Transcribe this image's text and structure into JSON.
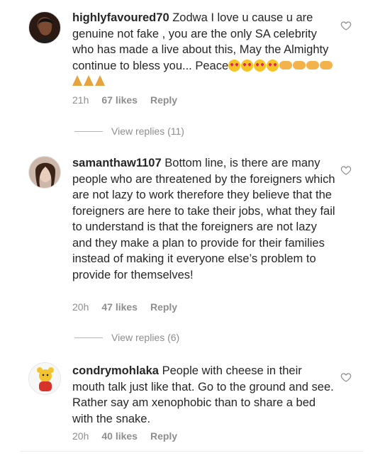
{
  "comments": [
    {
      "username": "highlyfavoured70",
      "text": "Zodwa I love u cause u are genuine not fake , you are the only SA celebrity who has made a live about this, May the Almighty continue to bless you... Peace",
      "emojis": [
        "heart-eyes",
        "heart-eyes",
        "heart-eyes",
        "heart-eyes",
        "handshake",
        "handshake",
        "handshake",
        "handshake",
        "pray",
        "pray",
        "pray"
      ],
      "time": "21h",
      "likes": "67 likes",
      "reply": "Reply",
      "view_replies": "View replies (11)"
    },
    {
      "username": "samanthaw1107",
      "text": "Bottom line, is there are many people who are threatened by the foreigners which are not lazy to work therefore they believe that the foreigners are here to take their jobs, what they fail to understand is that the foreigners are not lazy and they make a plan to provide for their families instead of making it everyone else’s problem to provide for themselves!",
      "time": "20h",
      "likes": "47 likes",
      "reply": "Reply",
      "view_replies": "View replies (6)"
    },
    {
      "username": "condrymohlaka",
      "text": "People with cheese in their mouth talk just like that.  Go to the ground and see. Rather say am xenophobic than to share a bed with the snake.",
      "time": "20h",
      "likes": "40 likes",
      "reply": "Reply"
    }
  ],
  "colors": {
    "text": "#262626",
    "meta": "#8e8e8e",
    "divider": "#efefef"
  }
}
